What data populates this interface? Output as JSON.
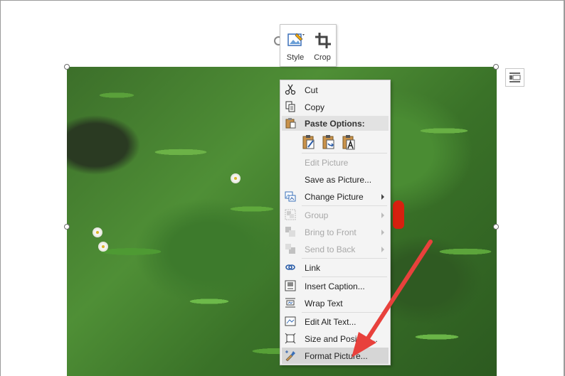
{
  "mini_toolbar": {
    "style_label": "Style",
    "crop_label": "Crop"
  },
  "context_menu": {
    "items": [
      {
        "id": "cut",
        "label": "Cut",
        "icon": "scissors-icon",
        "enabled": true
      },
      {
        "id": "copy",
        "label": "Copy",
        "icon": "copy-icon",
        "enabled": true
      },
      {
        "id": "paste_options",
        "label": "Paste Options:",
        "icon": "clipboard-icon",
        "section": true
      },
      {
        "id": "edit_picture",
        "label": "Edit Picture",
        "enabled": false
      },
      {
        "id": "save_as_picture",
        "label": "Save as Picture...",
        "enabled": true
      },
      {
        "id": "change_picture",
        "label": "Change Picture",
        "icon": "change-picture-icon",
        "enabled": true,
        "submenu": true
      },
      {
        "id": "group",
        "label": "Group",
        "icon": "group-icon",
        "enabled": false,
        "submenu": true
      },
      {
        "id": "bring_to_front",
        "label": "Bring to Front",
        "icon": "bring-front-icon",
        "enabled": false,
        "submenu": true
      },
      {
        "id": "send_to_back",
        "label": "Send to Back",
        "icon": "send-back-icon",
        "enabled": false,
        "submenu": true
      },
      {
        "id": "link",
        "label": "Link",
        "icon": "link-icon",
        "enabled": true
      },
      {
        "id": "insert_caption",
        "label": "Insert Caption...",
        "icon": "caption-icon",
        "enabled": true
      },
      {
        "id": "wrap_text",
        "label": "Wrap Text",
        "icon": "wrap-text-icon",
        "enabled": true
      },
      {
        "id": "edit_alt_text",
        "label": "Edit Alt Text...",
        "icon": "alt-text-icon",
        "enabled": true
      },
      {
        "id": "size_and_position",
        "label": "Size and Position...",
        "icon": "size-position-icon",
        "enabled": true
      },
      {
        "id": "format_picture",
        "label": "Format Picture...",
        "icon": "format-picture-icon",
        "enabled": true,
        "highlighted": true
      }
    ],
    "paste_option_icons": [
      "paste-keep-formatting-icon",
      "paste-merge-icon",
      "paste-text-only-icon"
    ]
  },
  "annotation": {
    "arrow_color": "#e8413c"
  }
}
